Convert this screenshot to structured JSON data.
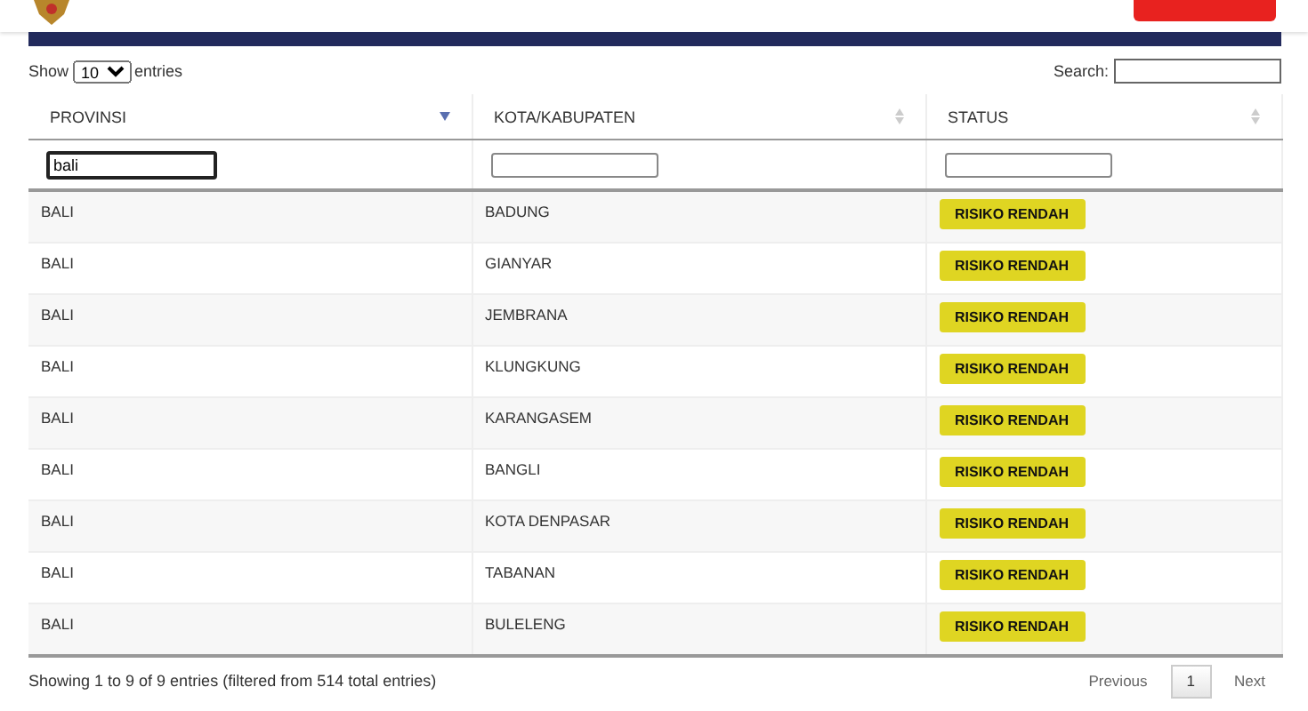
{
  "length_menu": {
    "label_before": "Show",
    "value": "10",
    "label_after": "entries"
  },
  "search": {
    "label": "Search:"
  },
  "table": {
    "columns": [
      {
        "label": "PROVINSI",
        "sorted": true
      },
      {
        "label": "KOTA/KABUPATEN",
        "sorted": false
      },
      {
        "label": "STATUS",
        "sorted": false
      }
    ],
    "filters": [
      {
        "value": "bali",
        "focused": true
      },
      {
        "focused": false
      },
      {
        "focused": false
      }
    ],
    "rows": [
      {
        "provinsi": "BALI",
        "kota": "BADUNG",
        "status": "RISIKO RENDAH"
      },
      {
        "provinsi": "BALI",
        "kota": "GIANYAR",
        "status": "RISIKO RENDAH"
      },
      {
        "provinsi": "BALI",
        "kota": "JEMBRANA",
        "status": "RISIKO RENDAH"
      },
      {
        "provinsi": "BALI",
        "kota": "KLUNGKUNG",
        "status": "RISIKO RENDAH"
      },
      {
        "provinsi": "BALI",
        "kota": "KARANGASEM",
        "status": "RISIKO RENDAH"
      },
      {
        "provinsi": "BALI",
        "kota": "BANGLI",
        "status": "RISIKO RENDAH"
      },
      {
        "provinsi": "BALI",
        "kota": "KOTA DENPASAR",
        "status": "RISIKO RENDAH"
      },
      {
        "provinsi": "BALI",
        "kota": "TABANAN",
        "status": "RISIKO RENDAH"
      },
      {
        "provinsi": "BALI",
        "kota": "BULELENG",
        "status": "RISIKO RENDAH"
      }
    ]
  },
  "info": "Showing 1 to 9 of 9 entries (filtered from 514 total entries)",
  "pagination": [
    {
      "label": "Previous",
      "selected": false
    },
    {
      "label": "1",
      "selected": true
    },
    {
      "label": "Next",
      "selected": false
    }
  ]
}
